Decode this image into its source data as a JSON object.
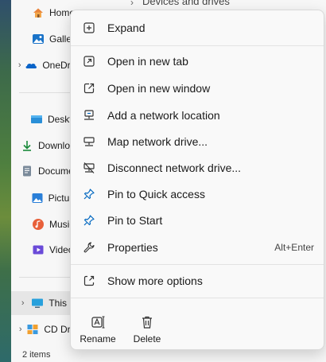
{
  "explorer": {
    "address_path": "Devices and drives",
    "status": "2 items",
    "nav_items": [
      {
        "label": "Home",
        "icon": "home-icon"
      },
      {
        "label": "Gallery",
        "icon": "gallery-icon"
      },
      {
        "label": "OneDrive",
        "icon": "onedrive-icon"
      },
      {
        "label": "Desktop",
        "icon": "desktop-icon"
      },
      {
        "label": "Downloads",
        "icon": "download-icon"
      },
      {
        "label": "Documents",
        "icon": "documents-icon"
      },
      {
        "label": "Pictures",
        "icon": "pictures-icon"
      },
      {
        "label": "Music",
        "icon": "music-icon"
      },
      {
        "label": "Videos",
        "icon": "videos-icon"
      },
      {
        "label": "This PC",
        "icon": "this-pc-icon"
      },
      {
        "label": "CD Drive",
        "icon": "cd-drive-icon"
      }
    ]
  },
  "context_menu": {
    "items": [
      {
        "label": "Expand",
        "icon": "expand-icon"
      },
      {
        "label": "Open in new tab",
        "icon": "new-tab-icon"
      },
      {
        "label": "Open in new window",
        "icon": "new-window-icon"
      },
      {
        "label": "Add a network location",
        "icon": "network-location-icon"
      },
      {
        "label": "Map network drive...",
        "icon": "map-drive-icon"
      },
      {
        "label": "Disconnect network drive...",
        "icon": "disconnect-drive-icon"
      },
      {
        "label": "Pin to Quick access",
        "icon": "pin-icon"
      },
      {
        "label": "Pin to Start",
        "icon": "pin-icon"
      },
      {
        "label": "Properties",
        "icon": "wrench-icon",
        "shortcut": "Alt+Enter"
      },
      {
        "label": "Show more options",
        "icon": "more-options-icon"
      }
    ],
    "quick_actions": [
      {
        "label": "Rename",
        "icon": "rename-icon"
      },
      {
        "label": "Delete",
        "icon": "trash-icon"
      }
    ]
  },
  "colors": {
    "accent": "#0067c0",
    "menu_background": "#f9f9f9",
    "selected_row": "#e6e6e6"
  }
}
